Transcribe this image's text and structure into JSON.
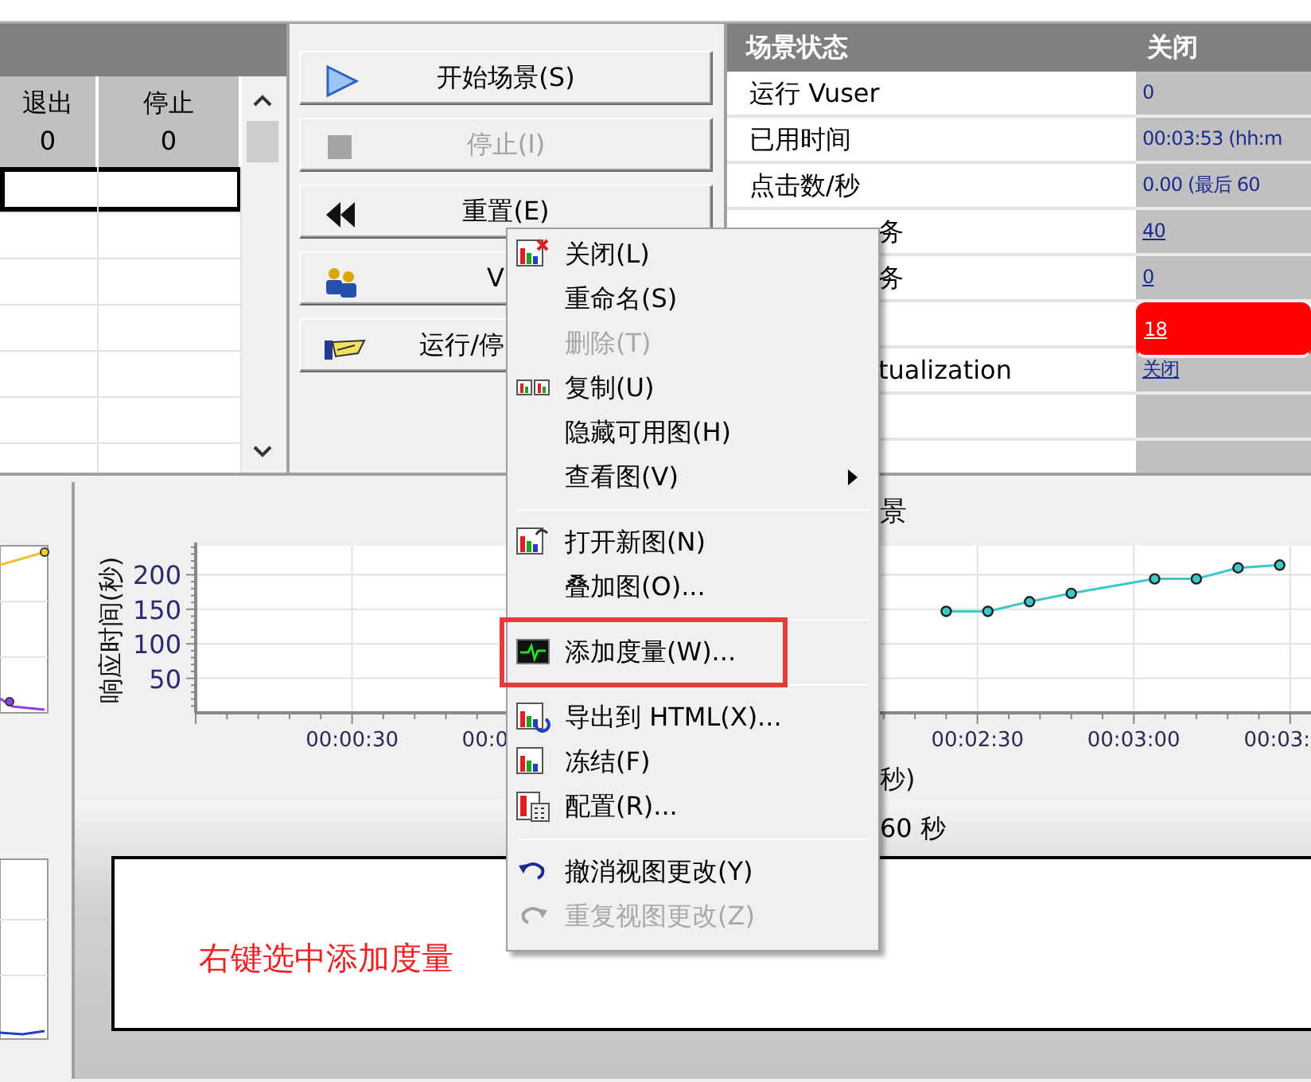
{
  "grid_panel": {
    "columns": [
      {
        "heading": "退出",
        "count": "0"
      },
      {
        "heading": "停止",
        "count": "0"
      }
    ],
    "rows": [
      {
        "selected": true
      },
      {
        "selected": false
      },
      {
        "selected": false
      },
      {
        "selected": false
      },
      {
        "selected": false
      },
      {
        "selected": false
      },
      {
        "selected": false
      }
    ]
  },
  "buttons": [
    {
      "label": "开始场景(S)",
      "disabled": false,
      "kind": "full"
    },
    {
      "label": "停止(I)",
      "disabled": true,
      "kind": "full"
    },
    {
      "label": "重置(E)",
      "disabled": false,
      "kind": "full"
    },
    {
      "label": "V",
      "disabled": false,
      "kind": "cut"
    },
    {
      "label": "运行/停",
      "disabled": false,
      "kind": "cut"
    }
  ],
  "scenario_status": {
    "title": "场景状态",
    "state": "关闭",
    "rows": [
      {
        "kind": "full",
        "label": "运行 Vuser",
        "value": "0",
        "link": false,
        "alert": false
      },
      {
        "kind": "full",
        "label": "已用时间",
        "value": "00:03:53 (hh:m",
        "link": false,
        "alert": false
      },
      {
        "kind": "full",
        "label": "点击数/秒",
        "value": "0.00 (最后 60",
        "link": false,
        "alert": false
      },
      {
        "kind": "cut",
        "label": "务",
        "value": "40",
        "link": true,
        "alert": false
      },
      {
        "kind": "cut",
        "label": "务",
        "value": "0",
        "link": true,
        "alert": false
      },
      {
        "kind": "value_only",
        "value": "18",
        "link": true,
        "alert": true
      },
      {
        "kind": "cut",
        "label": "tualization",
        "value": "关闭",
        "link": true,
        "alert": false
      },
      {
        "kind": "empty"
      },
      {
        "kind": "empty"
      }
    ]
  },
  "graph": {
    "cut_tick_labels": [
      "00:0",
      "00:03:"
    ],
    "chart_data": {
      "type": "line",
      "title": "景",
      "xlabel": "秒)",
      "ylabel": "响应时间(秒)",
      "x": [
        144,
        152,
        160,
        168,
        184,
        192,
        200,
        208
      ],
      "series": [
        {
          "color": "#3cc8c8",
          "marker": "circle",
          "values": [
            147,
            147,
            161,
            173,
            194,
            194,
            210,
            214
          ]
        }
      ],
      "xlim": [
        0,
        214
      ],
      "ylim": [
        0,
        242
      ],
      "xticks": [
        {
          "value": 30,
          "label": "00:00:30"
        },
        {
          "value": 150,
          "label": "00:02:30"
        },
        {
          "value": 180,
          "label": "00:03:00"
        }
      ],
      "grid": true,
      "yticks": [
        50,
        100,
        150,
        200
      ]
    }
  },
  "bottom_panel": {
    "caption": "60 秒",
    "note": "右键选中添加度量"
  },
  "context_menu": {
    "items": [
      {
        "kind": "item",
        "label": "关闭(L)",
        "disabled": false,
        "submenu": false,
        "outlined": false
      },
      {
        "kind": "item",
        "label": "重命名(S)",
        "disabled": false,
        "submenu": false,
        "outlined": false
      },
      {
        "kind": "item",
        "label": "删除(T)",
        "disabled": true,
        "submenu": false,
        "outlined": false
      },
      {
        "kind": "item",
        "label": "复制(U)",
        "disabled": false,
        "submenu": false,
        "outlined": false
      },
      {
        "kind": "item",
        "label": "隐藏可用图(H)",
        "disabled": false,
        "submenu": false,
        "outlined": false
      },
      {
        "kind": "item",
        "label": "查看图(V)",
        "disabled": false,
        "submenu": true,
        "outlined": false
      },
      {
        "kind": "separator"
      },
      {
        "kind": "item",
        "label": "打开新图(N)",
        "disabled": false,
        "submenu": false,
        "outlined": false
      },
      {
        "kind": "item",
        "label": "叠加图(O)...",
        "disabled": false,
        "submenu": false,
        "outlined": false
      },
      {
        "kind": "separator"
      },
      {
        "kind": "item",
        "label": "添加度量(W)...",
        "disabled": false,
        "submenu": false,
        "outlined": true
      },
      {
        "kind": "separator"
      },
      {
        "kind": "item",
        "label": "导出到 HTML(X)...",
        "disabled": false,
        "submenu": false,
        "outlined": false
      },
      {
        "kind": "item",
        "label": "冻结(F)",
        "disabled": false,
        "submenu": false,
        "outlined": false
      },
      {
        "kind": "item",
        "label": "配置(R)...",
        "disabled": false,
        "submenu": false,
        "outlined": false
      },
      {
        "kind": "separator"
      },
      {
        "kind": "item",
        "label": "撤消视图更改(Y)",
        "disabled": false,
        "submenu": false,
        "outlined": false
      },
      {
        "kind": "item",
        "label": "重复视图更改(Z)",
        "disabled": true,
        "submenu": false,
        "outlined": false
      }
    ]
  }
}
